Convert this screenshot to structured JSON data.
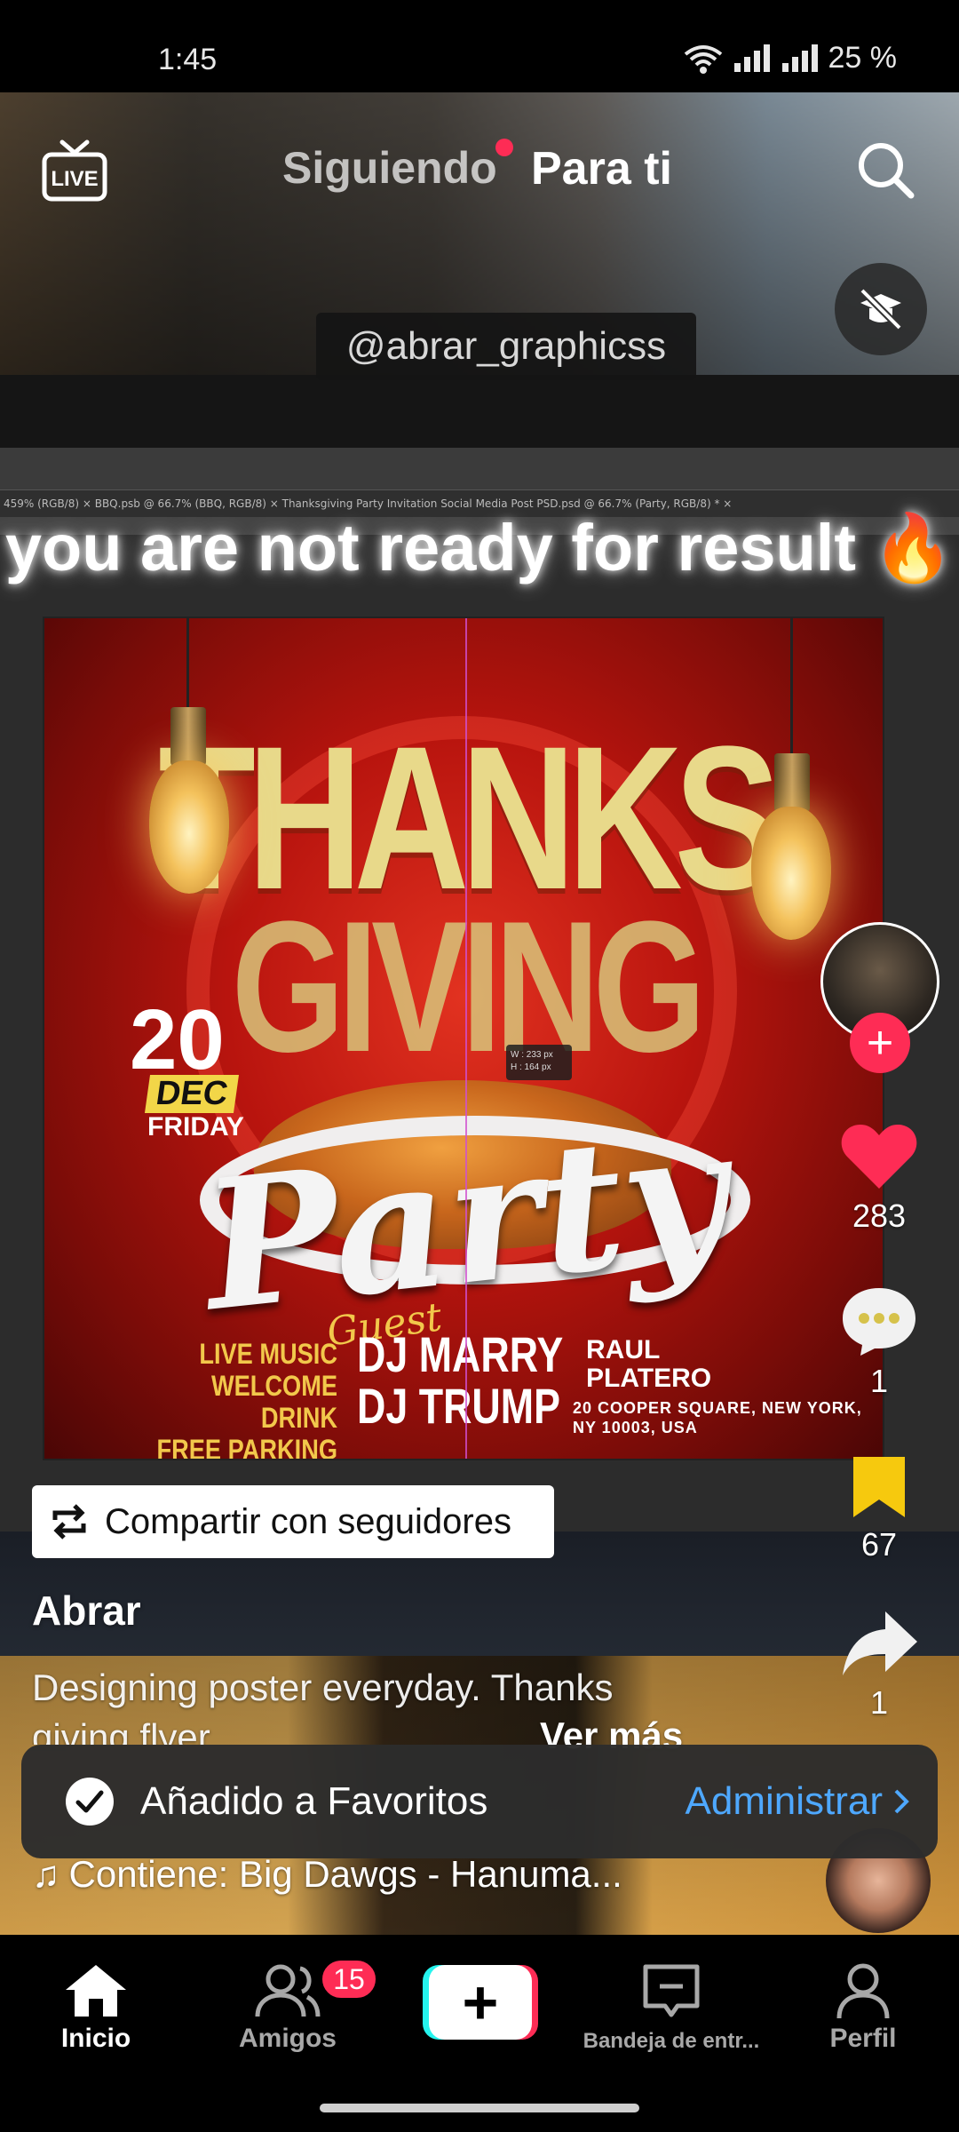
{
  "status_bar": {
    "time": "1:45",
    "battery": "25 %"
  },
  "header": {
    "live_label": "LIVE",
    "tab_following": "Siguiendo",
    "tab_for_you": "Para ti"
  },
  "video": {
    "watermark": "@abrar_graphicss",
    "caption": "you are not ready for result",
    "caption_emoji": "🔥",
    "ps_tabs": "459% (RGB/8)  ×    BBQ.psb @ 66.7% (BBQ, RGB/8)  ×    Thanksgiving Party Invitation Social Media Post PSD.psd @ 66.7% (Party, RGB/8) *  ×",
    "poster": {
      "title_line1": "THANKS",
      "title_line2": "GIVING",
      "date_num": "20",
      "date_month": "DEC",
      "date_day": "FRIDAY",
      "party": "Party",
      "guest": "Guest",
      "dj1": "DJ MARRY",
      "dj2": "DJ TRUMP",
      "extra1": "LIVE MUSIC",
      "extra2": "WELCOME DRINK",
      "extra3": "FREE PARKING",
      "brand_line1": "RAUL",
      "brand_line2": "PLATERO",
      "address_line1": "20 COOPER SQUARE, NEW YORK,",
      "address_line2": "NY 10003, USA",
      "measure_w": "W : 233 px",
      "measure_h": "H : 164 px"
    }
  },
  "rail": {
    "likes": "283",
    "comments": "1",
    "favorites": "67",
    "shares": "1"
  },
  "share_chip": {
    "label": "Compartir con seguidores"
  },
  "post": {
    "author": "Abrar",
    "description": "Designing poster everyday. Thanks giving flyer",
    "more": "Ver más",
    "music": "Contiene: Big Dawgs - Hanuma..."
  },
  "toast": {
    "message": "Añadido a Favoritos",
    "action": "Administrar"
  },
  "bottom_nav": {
    "home": "Inicio",
    "friends": "Amigos",
    "friends_badge": "15",
    "inbox": "Bandeja de entr...",
    "profile": "Perfil"
  },
  "colors": {
    "accent_red": "#fe2c55",
    "accent_cyan": "#25f4ee",
    "favorite_yellow": "#f6c90e",
    "link_blue": "#4ea8ff"
  }
}
